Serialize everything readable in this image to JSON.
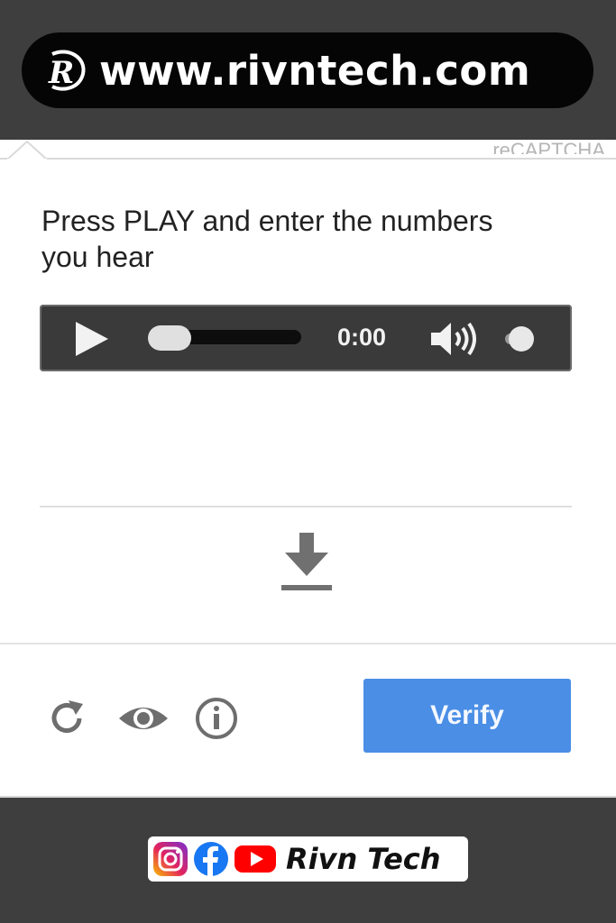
{
  "banner": {
    "url": "www.rivntech.com",
    "logo_icon": "rivntech-r-logo"
  },
  "captcha": {
    "brand": "reCAPTCHA",
    "instructions": "Press PLAY and enter the numbers you hear",
    "player": {
      "time": "0:00",
      "progress": 0.0,
      "play_icon": "play-icon",
      "volume_icon": "volume-icon"
    },
    "download_icon": "download-icon",
    "controls": {
      "reload_icon": "reload-icon",
      "visual_icon": "eye-icon",
      "info_icon": "info-icon"
    },
    "verify_label": "Verify",
    "verify_color": "#4a8ee6"
  },
  "footer": {
    "social_icons": [
      "instagram-icon",
      "facebook-icon",
      "youtube-icon"
    ],
    "name": "Rivn Tech"
  }
}
